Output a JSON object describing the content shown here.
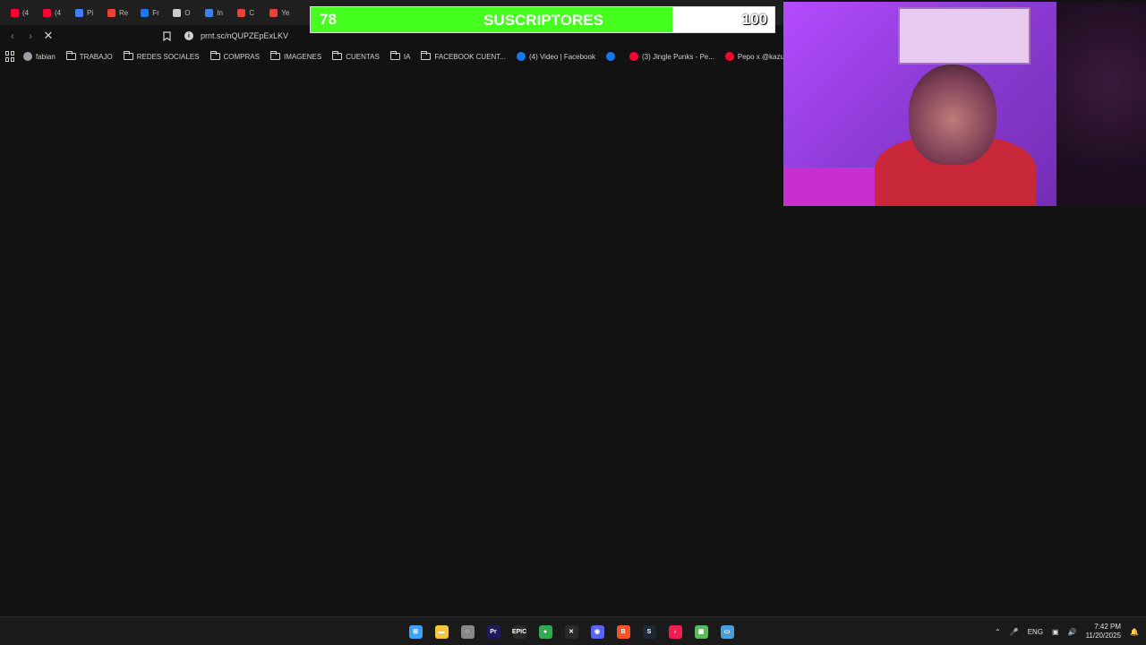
{
  "browser": {
    "tabs": [
      {
        "label": "(4",
        "color": "#ff0033"
      },
      {
        "label": "(4",
        "color": "#ff0033"
      },
      {
        "label": "Pi",
        "color": "#3b82f6"
      },
      {
        "label": "Re",
        "color": "#ea4335"
      },
      {
        "label": "Fr",
        "color": "#1877f2"
      },
      {
        "label": "O",
        "color": "#cccccc"
      },
      {
        "label": "In",
        "color": "#3b82f6"
      },
      {
        "label": "C",
        "color": "#ea4335"
      },
      {
        "label": "Ye",
        "color": "#ea4335"
      }
    ],
    "address": "prnt.sc/nQUPZEpExLKV",
    "bookmarks": [
      {
        "label": "fabian",
        "icon": "globe-icon"
      },
      {
        "label": "TRABAJO",
        "icon": "folder-icon"
      },
      {
        "label": "REDES SOCIALES",
        "icon": "folder-icon"
      },
      {
        "label": "COMPRAS",
        "icon": "folder-icon"
      },
      {
        "label": "IMAGENES",
        "icon": "folder-icon"
      },
      {
        "label": "CUENTAS",
        "icon": "folder-icon"
      },
      {
        "label": "IA",
        "icon": "folder-icon"
      },
      {
        "label": "FACEBOOK CUENT...",
        "icon": "folder-icon"
      },
      {
        "label": "(4) Video | Facebook",
        "icon": "facebook-icon"
      },
      {
        "label": "",
        "icon": "facebook-icon"
      },
      {
        "label": "(3) Jingle Punks - Pe...",
        "icon": "youtube-icon"
      },
      {
        "label": "Pepo x @kazu.oficia...",
        "icon": "youtube-icon"
      }
    ]
  },
  "subscriber_goal": {
    "current": "78",
    "title": "SUSCRIPTORES",
    "goal": "100",
    "progress_fraction": 0.78,
    "fill_color": "#45ff1f"
  },
  "taskbar": {
    "apps": [
      {
        "name": "windows-start-icon",
        "glyph": "⊞",
        "color": "#3ba3ff"
      },
      {
        "name": "file-explorer-icon",
        "glyph": "▬",
        "color": "#f5c542"
      },
      {
        "name": "obs-icon",
        "glyph": "○",
        "color": "#888888"
      },
      {
        "name": "premiere-icon",
        "glyph": "Pr",
        "color": "#1f1a5c"
      },
      {
        "name": "epic-games-icon",
        "glyph": "EPIC",
        "color": "#2a2a2a"
      },
      {
        "name": "chrome-icon",
        "glyph": "●",
        "color": "#34a853"
      },
      {
        "name": "capcut-icon",
        "glyph": "✕",
        "color": "#2a2a2a"
      },
      {
        "name": "discord-icon",
        "glyph": "◉",
        "color": "#5865f2"
      },
      {
        "name": "brave-icon",
        "glyph": "B",
        "color": "#fb542b"
      },
      {
        "name": "steam-icon",
        "glyph": "S",
        "color": "#1b2838"
      },
      {
        "name": "tiktok-icon",
        "glyph": "♪",
        "color": "#ee1d52"
      },
      {
        "name": "image-viewer-icon",
        "glyph": "▣",
        "color": "#5cb85c"
      },
      {
        "name": "snipping-tool-icon",
        "glyph": "▭",
        "color": "#4a9eda"
      }
    ],
    "tray": {
      "language": "ENG",
      "time": "7:42 PM",
      "date": "11/20/2025"
    }
  }
}
